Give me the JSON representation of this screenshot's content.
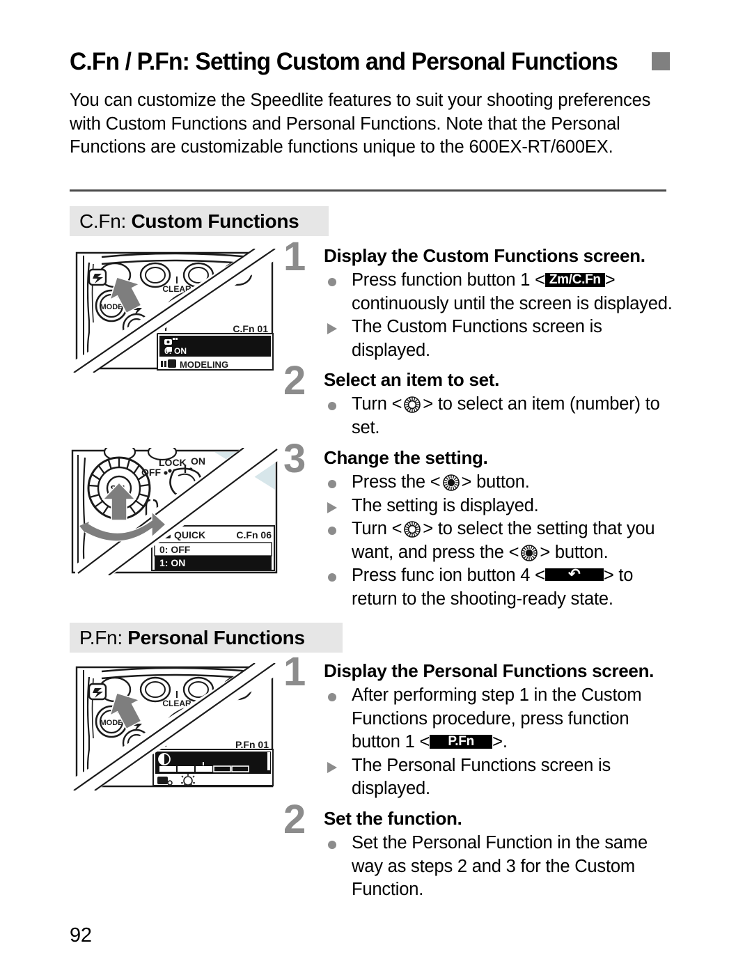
{
  "header": {
    "title": "C.Fn / P.Fn: Setting Custom and Personal Functions",
    "marker_color": "#808080"
  },
  "intro": {
    "text": "You can customize the Speedlite features to suit your shooting preferences with Custom Functions and Personal Functions. Note that the Personal Functions are customizable functions unique to the 600EX-RT/600EX."
  },
  "sections": [
    {
      "id": "cfn",
      "band_prefix": "C.Fn:",
      "band_title": "Custom Functions",
      "band_bg": "#e6e6e6"
    },
    {
      "id": "pfn",
      "band_prefix": "P.Fn:",
      "band_title": "Personal Functions",
      "band_bg": "#e6e6e6"
    }
  ],
  "steps": {
    "cfn1": {
      "number": "1",
      "title": "Display the Custom Functions screen.",
      "b1_pre": "Press function button 1 <",
      "b1_badge": "Zm/C.Fn",
      "b1_post": "> continuously until the screen is displayed.",
      "b2": "The Custom Functions screen is displayed."
    },
    "cfn2": {
      "number": "2",
      "title": "Select an item to set.",
      "b1_pre": "Turn <",
      "b1_post": "> to select an item (number) to set."
    },
    "cfn3": {
      "number": "3",
      "title": "Change the setting.",
      "b1_pre": "Press the <",
      "b1_post": "> button.",
      "b2": "The setting is displayed.",
      "b3_pre": "Turn <",
      "b3_mid": "> to select the setting that you want, and press the <",
      "b3_post": "> button.",
      "b4_pre": "Press func ion button 4 <",
      "b4_badge": "↶",
      "b4_post": "> to return to the shooting-ready state."
    },
    "pfn1": {
      "number": "1",
      "title": "Display the Personal Functions screen.",
      "b1_pre": "After performing step 1 in the Custom Functions procedure, press function button 1 <",
      "b1_badge": "P.Fn",
      "b1_post": ">.",
      "b2": "The Personal Functions screen is displayed."
    },
    "pfn2": {
      "number": "2",
      "title": "Set the function.",
      "b1": "Set the Personal Function in the same way as steps 2 and 3 for the Custom Function."
    }
  },
  "illustrations": {
    "cfn_step1": {
      "name": "speedlite-top-buttons-cfn",
      "button_label": "CLEAR",
      "mode_label": "MODE",
      "lcd_code": "C.Fn 01",
      "lcd_value": "0: ON",
      "lcd_caption": "MODELING"
    },
    "cfn_step3": {
      "name": "speedlite-dial-lock-switch",
      "switch_lock": "LOCK",
      "switch_on": "ON",
      "switch_off": "OFF",
      "dial_label": "SEL",
      "lcd_caption": "QUICK",
      "lcd_code": "C.Fn 06",
      "lcd_option_1": "0: OFF",
      "lcd_option_2": "1: ON"
    },
    "pfn_step1": {
      "name": "speedlite-top-buttons-pfn",
      "button_label": "CLEAR",
      "mode_label": "MODE",
      "lcd_code": "P.Fn 01"
    }
  },
  "footer": {
    "page_number": "92"
  },
  "icons": {
    "dial": "control-dial-icon",
    "set_button": "set-button-icon",
    "bullet_dot": "bullet-dot-icon",
    "bullet_triangle": "result-arrow-icon"
  }
}
